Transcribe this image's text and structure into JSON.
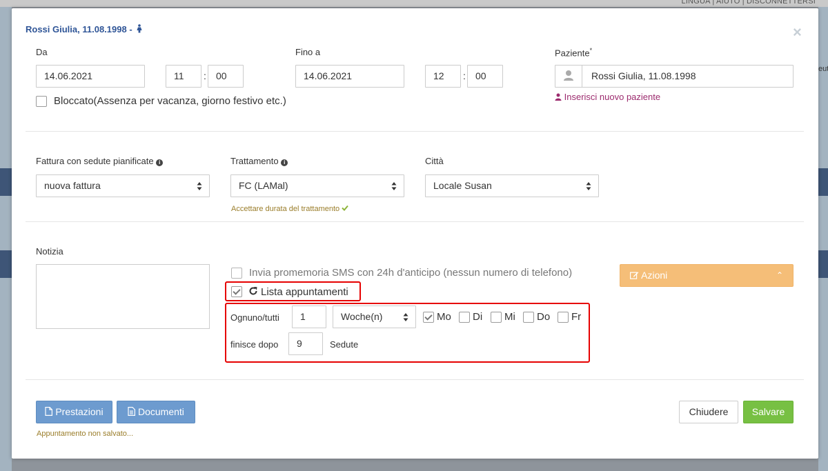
{
  "top_nav": {
    "links": "LINGUA  |  AIUTO  |  DISCONNETTERSI"
  },
  "bg_right_text": "eut",
  "modal": {
    "title": "Rossi Giulia, 11.08.1998 -",
    "close_symbol": "×"
  },
  "from": {
    "label": "Da",
    "date": "14.06.2021",
    "hour": "11",
    "minute": "00",
    "time_sep": ":"
  },
  "to": {
    "label": "Fino a",
    "date": "14.06.2021",
    "hour": "12",
    "minute": "00",
    "time_sep": ":"
  },
  "patient": {
    "label": "Paziente",
    "required_mark": "*",
    "value": "Rossi Giulia, 11.08.1998",
    "new_patient_link": "Inserisci nuovo paziente"
  },
  "blocked": {
    "label": "Bloccato(Assenza per vacanza, giorno festivo etc.)",
    "checked": false
  },
  "invoice": {
    "label": "Fattura con sedute pianificate",
    "value": "nuova fattura"
  },
  "treatment": {
    "label": "Trattamento",
    "value": "FC (LAMal)",
    "accept_duration": "Accettare durata del trattamento"
  },
  "city": {
    "label": "Città",
    "value": "Locale Susan"
  },
  "note": {
    "label": "Notizia",
    "value": ""
  },
  "sms": {
    "label": "Invia promemoria SMS con 24h d'anticipo (nessun numero di telefono)",
    "checked": false
  },
  "actions": {
    "label": "Azioni"
  },
  "recurrence": {
    "label": "Lista appuntamenti",
    "checked": true,
    "every_label": "Ognuno/tutti",
    "every_value": "1",
    "unit": "Woche(n)",
    "days": [
      {
        "label": "Mo",
        "checked": true
      },
      {
        "label": "Di",
        "checked": false
      },
      {
        "label": "Mi",
        "checked": false
      },
      {
        "label": "Do",
        "checked": false
      },
      {
        "label": "Fr",
        "checked": false
      }
    ],
    "ends_after_label": "finisce dopo",
    "ends_after_value": "9",
    "sessions_label": "Sedute"
  },
  "footer": {
    "services_button": "Prestazioni",
    "documents_button": "Documenti",
    "unsaved_note": "Appuntamento non salvato...",
    "close_button": "Chiudere",
    "save_button": "Salvare"
  },
  "colors": {
    "title_blue": "#2f5597",
    "link_purple": "#9c2b6e",
    "olive_note": "#9a7d2a",
    "button_blue": "#6d9bcf",
    "save_green": "#77c043",
    "actions_orange": "#f5be78",
    "highlight_red": "#e60000"
  }
}
